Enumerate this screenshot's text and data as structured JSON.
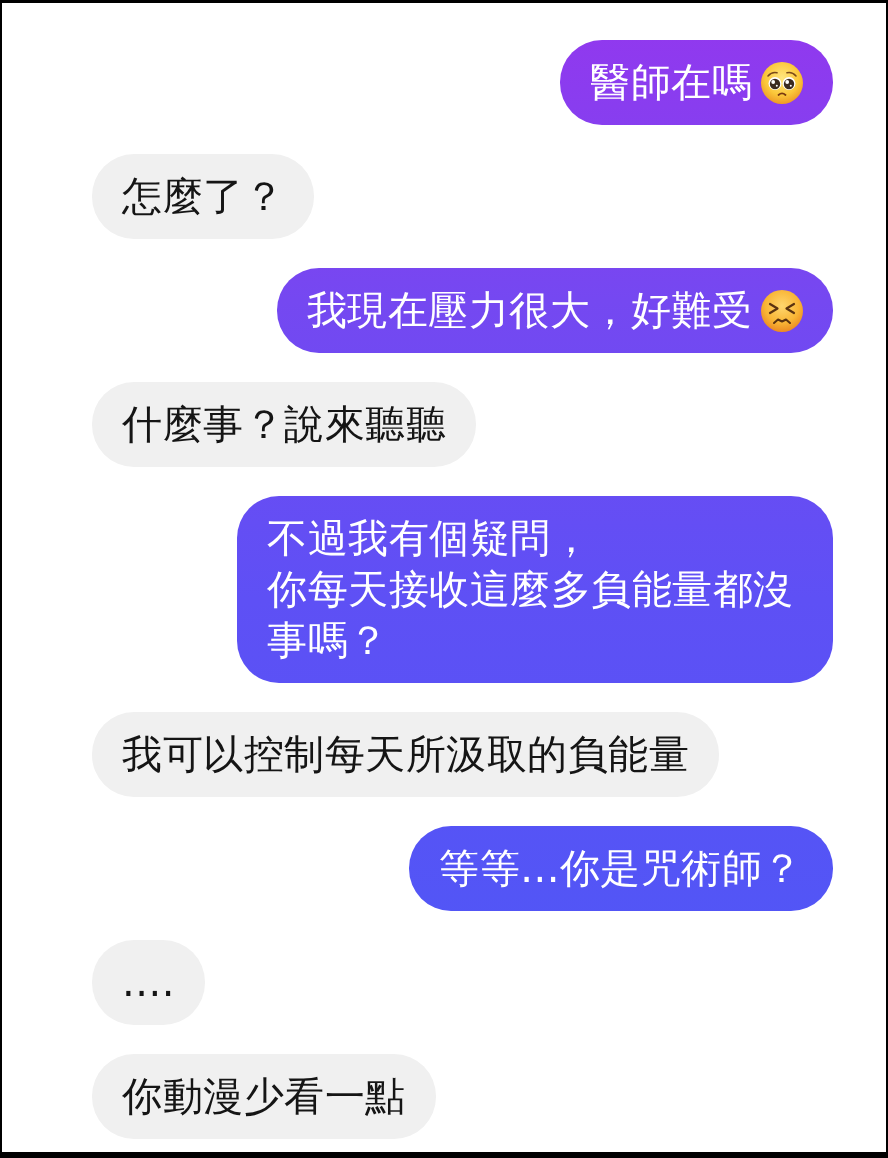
{
  "messages": [
    {
      "kind": "sent",
      "lines": [
        "醫師在嗎"
      ],
      "emoji": {
        "kind": "pleading"
      }
    },
    {
      "kind": "received",
      "lines": [
        "怎麼了？"
      ]
    },
    {
      "kind": "sent",
      "lines": [
        "我現在壓力很大，好難受"
      ],
      "emoji": {
        "kind": "persevering"
      }
    },
    {
      "kind": "received",
      "lines": [
        "什麼事？說來聽聽"
      ]
    },
    {
      "kind": "sent",
      "lines": [
        "不過我有個疑問，",
        "你每天接收這麼多負能量都沒事嗎？"
      ]
    },
    {
      "kind": "received",
      "lines": [
        "我可以控制每天所汲取的負能量"
      ]
    },
    {
      "kind": "sent",
      "lines": [
        "等等...你是咒術師？"
      ]
    },
    {
      "kind": "received",
      "lines": [
        "...."
      ]
    },
    {
      "kind": "received",
      "lines": [
        "你動漫少看一點"
      ]
    }
  ]
}
